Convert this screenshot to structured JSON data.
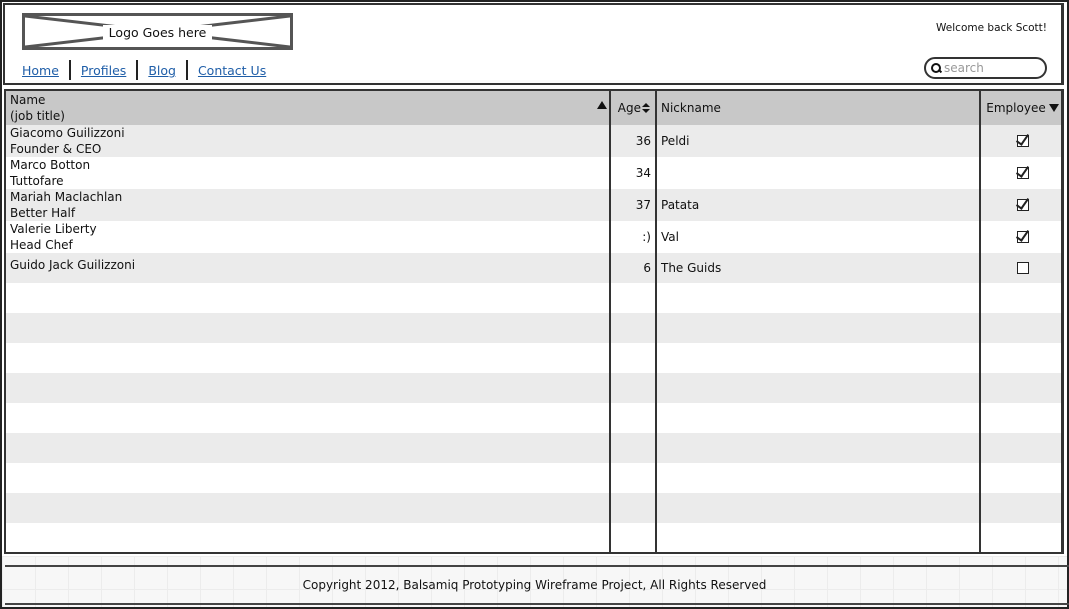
{
  "header": {
    "logo_text": "Logo Goes here",
    "welcome": "Welcome back Scott!",
    "search": {
      "placeholder": "search",
      "value": "",
      "icon": "search-icon"
    },
    "nav": [
      {
        "label": "Home"
      },
      {
        "label": "Profiles"
      },
      {
        "label": "Blog"
      },
      {
        "label": "Contact Us"
      }
    ]
  },
  "table": {
    "columns": {
      "name": {
        "line1": "Name",
        "line2": "(job title)",
        "sort": "ascending"
      },
      "age": {
        "label": "Age",
        "sort": "sortable"
      },
      "nickname": {
        "label": "Nickname"
      },
      "employee": {
        "label": "Employee",
        "sort": "dropdown"
      }
    },
    "rows": [
      {
        "name": "Giacomo Guilizzoni",
        "title": "Founder & CEO",
        "age": "36",
        "nickname": "Peldi",
        "employee": true
      },
      {
        "name": "Marco Botton",
        "title": "Tuttofare",
        "age": "34",
        "nickname": "",
        "employee": true
      },
      {
        "name": "Mariah Maclachlan",
        "title": "Better Half",
        "age": "37",
        "nickname": "Patata",
        "employee": true
      },
      {
        "name": "Valerie Liberty",
        "title": "Head Chef",
        "age": ":)",
        "nickname": "Val",
        "employee": true
      },
      {
        "name": "Guido Jack Guilizzoni",
        "title": "",
        "age": "6",
        "nickname": "The Guids",
        "employee": false
      }
    ],
    "empty_rows": 9
  },
  "footer": {
    "copyright": "Copyright 2012, Balsamiq Prototyping Wireframe Project, All Rights Reserved"
  },
  "colors": {
    "link": "#1f5ea8",
    "header_bg": "#c8c8c8",
    "row_alt": "#ebebeb",
    "border": "#333333"
  }
}
